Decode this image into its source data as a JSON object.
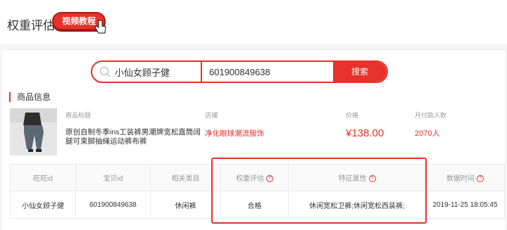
{
  "header": {
    "title": "权重评估",
    "video_badge": "视频教程"
  },
  "search": {
    "keyword_value": "小仙女顾子健",
    "id_value": "601900849638",
    "button_label": "搜索"
  },
  "product_section": {
    "title": "商品信息",
    "columns": {
      "title": "商品标题",
      "shop": "店铺",
      "price": "价格",
      "monthly_buyers": "月付款人数"
    },
    "product": {
      "title": "原创自制冬季ins工装裤男潮牌宽松直筒阔腿可束脚抽绳运动裤布裤",
      "shop": "净化眼球潮流服饰",
      "price": "¥138.00",
      "monthly_buyers": "2070人"
    }
  },
  "table": {
    "headers": [
      "旺旺id",
      "宝贝id",
      "相关类目",
      "权重评估",
      "特征属性",
      "数据时间"
    ],
    "headers_with_help": [
      false,
      false,
      false,
      true,
      true,
      true
    ],
    "rows": [
      [
        "小仙女顾子健",
        "601900849638",
        "休闲裤",
        "合格",
        "休闲宽松卫裤;休闲宽松西装裤;",
        "2019-11-25 18:05:45"
      ]
    ],
    "help_glyph": "?"
  },
  "colors": {
    "accent": "#e8312a"
  }
}
